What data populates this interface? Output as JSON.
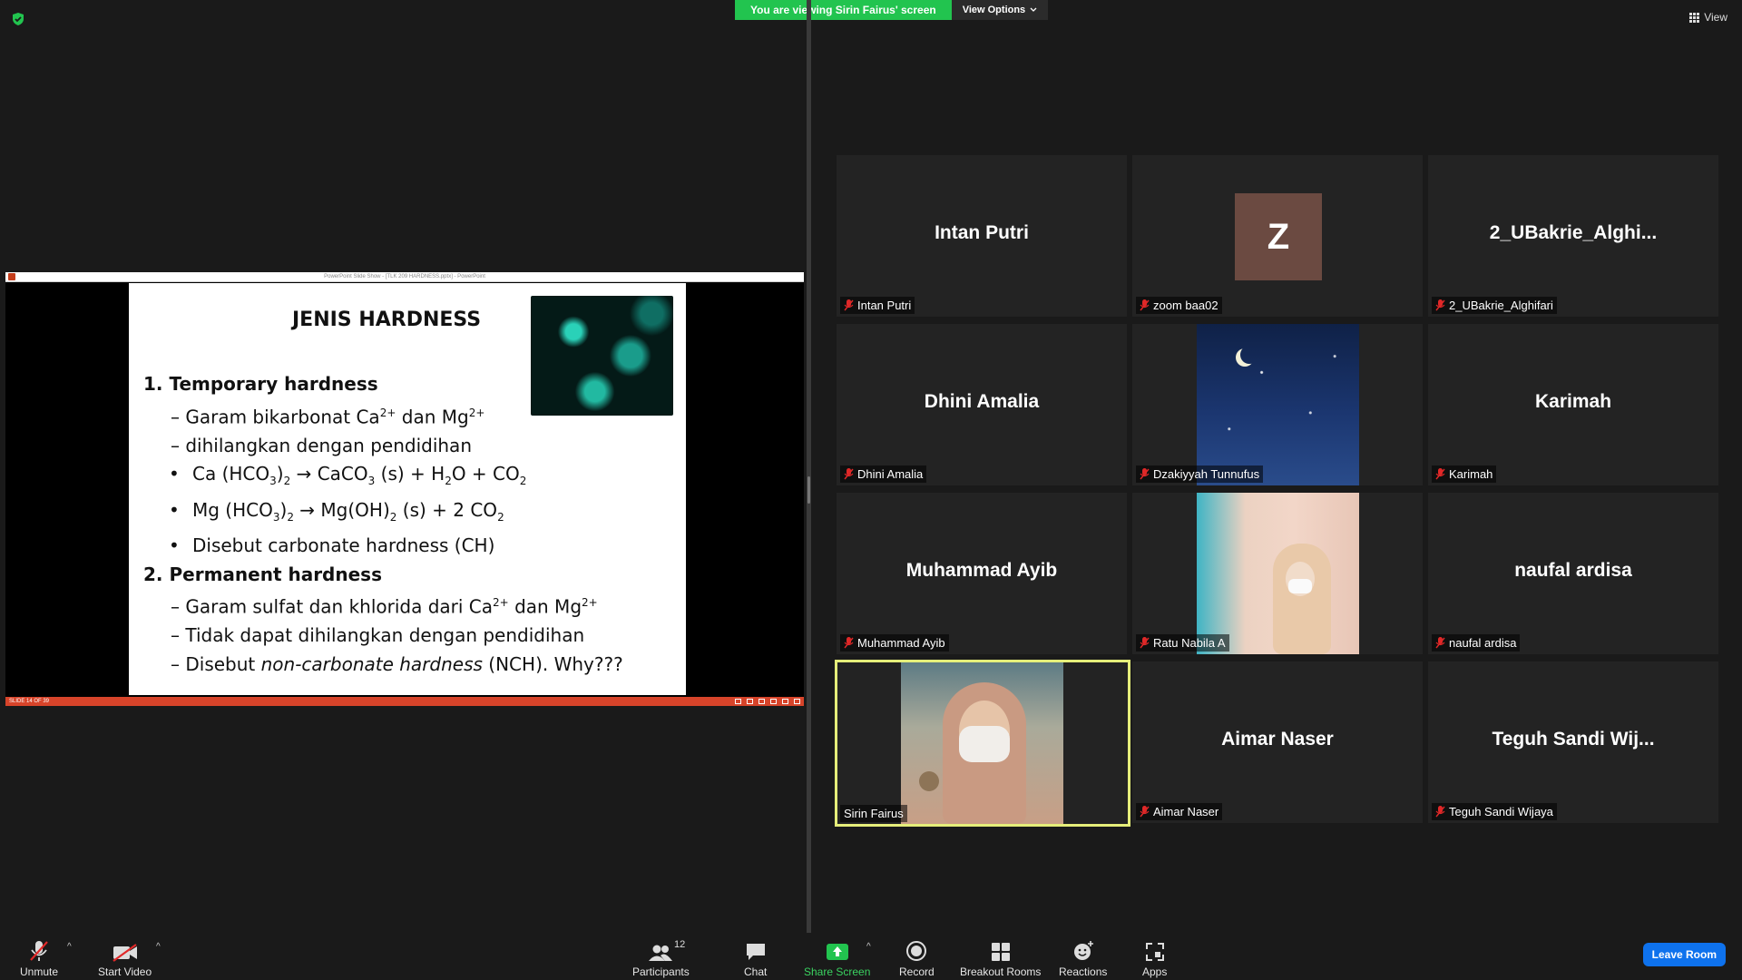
{
  "banner": {
    "viewing_text": "You are viewing Sirin Fairus' screen",
    "view_options_label": "View Options"
  },
  "top_right": {
    "view_label": "View"
  },
  "shared_screen": {
    "ppt_title": "PowerPoint Slide Show - [TLK 209 HARDNESS.pptx] - PowerPoint",
    "status_text": "SLIDE 14 OF 39",
    "slide": {
      "title": "JENIS HARDNESS",
      "lines": [
        "1. Temporary hardness",
        "– Garam bikarbonat Ca",
        "2+",
        " dan Mg",
        "2+",
        "– dihilangkan dengan pendidihan",
        "Ca (HCO",
        "3",
        ")",
        "2",
        " → CaCO",
        "3",
        " (s)    + H",
        "2",
        "O + CO",
        "2",
        "Mg (HCO",
        "3",
        ")",
        "2",
        " → Mg(OH)",
        "2",
        " (s)    + 2 CO",
        "2",
        "Disebut carbonate hardness (CH)",
        "2. Permanent hardness",
        "– Garam sulfat dan khlorida dari Ca",
        "2+",
        " dan Mg",
        "2+",
        "– Tidak dapat dihilangkan dengan pendidihan",
        "– Disebut ",
        "non-carbonate hardness",
        " (NCH). Why???"
      ]
    }
  },
  "participants": [
    {
      "big_name": "Intan Putri",
      "label": "Intan Putri",
      "muted": true
    },
    {
      "avatar_letter": "Z",
      "label": "zoom baa02",
      "muted": true
    },
    {
      "big_name": "2_UBakrie_Alghi...",
      "label": "2_UBakrie_Alghifari",
      "muted": true
    },
    {
      "big_name": "Dhini Amalia",
      "label": "Dhini Amalia",
      "muted": true
    },
    {
      "label": "Dzakiyyah Tunnufus",
      "muted": true
    },
    {
      "big_name": "Karimah",
      "label": "Karimah",
      "muted": true
    },
    {
      "big_name": "Muhammad Ayib",
      "label": "Muhammad Ayib",
      "muted": true
    },
    {
      "label": "Ratu Nabila A",
      "muted": true
    },
    {
      "big_name": "naufal ardisa",
      "label": "naufal ardisa",
      "muted": true
    },
    {
      "label": "Sirin Fairus",
      "muted": false,
      "active_speaker": true
    },
    {
      "big_name": "Aimar Naser",
      "label": "Aimar Naser",
      "muted": true
    },
    {
      "big_name": "Teguh Sandi Wij...",
      "label": "Teguh Sandi Wijaya",
      "muted": true
    }
  ],
  "toolbar": {
    "unmute": "Unmute",
    "start_video": "Start Video",
    "participants": "Participants",
    "participants_count": "12",
    "chat": "Chat",
    "share_screen": "Share Screen",
    "record": "Record",
    "breakout_rooms": "Breakout Rooms",
    "reactions": "Reactions",
    "apps": "Apps",
    "leave": "Leave Room"
  },
  "colors": {
    "banner_green": "#22c44f",
    "leave_blue": "#0e72ed",
    "active_border": "#e5ee7a",
    "muted_red": "#e02828",
    "slide_status_red": "#d7442a"
  },
  "icons": [
    "shield-icon",
    "chevron-down-icon",
    "grid-view-icon",
    "mic-muted-icon",
    "video-off-icon",
    "participants-icon",
    "chat-icon",
    "share-screen-icon",
    "record-icon",
    "breakout-rooms-icon",
    "reactions-icon",
    "apps-icon"
  ]
}
